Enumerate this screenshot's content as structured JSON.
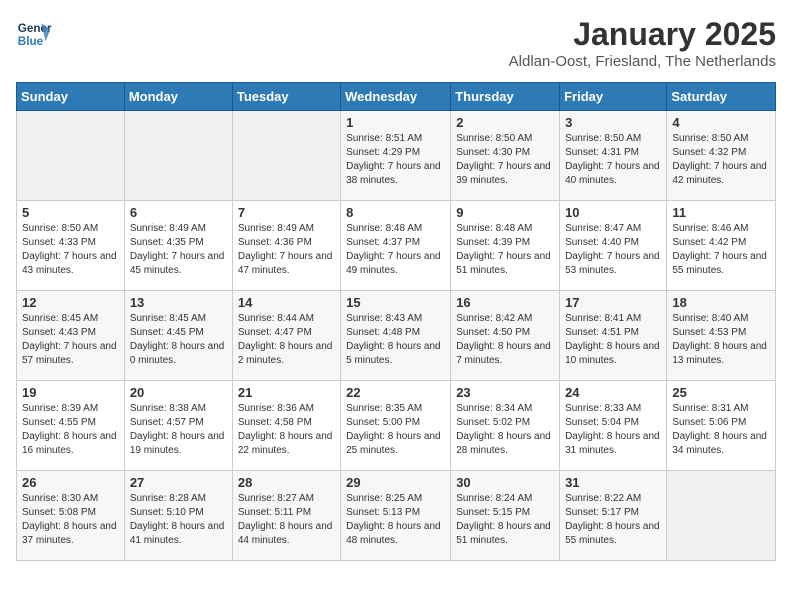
{
  "header": {
    "logo_line1": "General",
    "logo_line2": "Blue",
    "title": "January 2025",
    "subtitle": "Aldlan-Oost, Friesland, The Netherlands"
  },
  "weekdays": [
    "Sunday",
    "Monday",
    "Tuesday",
    "Wednesday",
    "Thursday",
    "Friday",
    "Saturday"
  ],
  "weeks": [
    [
      {
        "day": "",
        "info": ""
      },
      {
        "day": "",
        "info": ""
      },
      {
        "day": "",
        "info": ""
      },
      {
        "day": "1",
        "info": "Sunrise: 8:51 AM\nSunset: 4:29 PM\nDaylight: 7 hours and 38 minutes."
      },
      {
        "day": "2",
        "info": "Sunrise: 8:50 AM\nSunset: 4:30 PM\nDaylight: 7 hours and 39 minutes."
      },
      {
        "day": "3",
        "info": "Sunrise: 8:50 AM\nSunset: 4:31 PM\nDaylight: 7 hours and 40 minutes."
      },
      {
        "day": "4",
        "info": "Sunrise: 8:50 AM\nSunset: 4:32 PM\nDaylight: 7 hours and 42 minutes."
      }
    ],
    [
      {
        "day": "5",
        "info": "Sunrise: 8:50 AM\nSunset: 4:33 PM\nDaylight: 7 hours and 43 minutes."
      },
      {
        "day": "6",
        "info": "Sunrise: 8:49 AM\nSunset: 4:35 PM\nDaylight: 7 hours and 45 minutes."
      },
      {
        "day": "7",
        "info": "Sunrise: 8:49 AM\nSunset: 4:36 PM\nDaylight: 7 hours and 47 minutes."
      },
      {
        "day": "8",
        "info": "Sunrise: 8:48 AM\nSunset: 4:37 PM\nDaylight: 7 hours and 49 minutes."
      },
      {
        "day": "9",
        "info": "Sunrise: 8:48 AM\nSunset: 4:39 PM\nDaylight: 7 hours and 51 minutes."
      },
      {
        "day": "10",
        "info": "Sunrise: 8:47 AM\nSunset: 4:40 PM\nDaylight: 7 hours and 53 minutes."
      },
      {
        "day": "11",
        "info": "Sunrise: 8:46 AM\nSunset: 4:42 PM\nDaylight: 7 hours and 55 minutes."
      }
    ],
    [
      {
        "day": "12",
        "info": "Sunrise: 8:45 AM\nSunset: 4:43 PM\nDaylight: 7 hours and 57 minutes."
      },
      {
        "day": "13",
        "info": "Sunrise: 8:45 AM\nSunset: 4:45 PM\nDaylight: 8 hours and 0 minutes."
      },
      {
        "day": "14",
        "info": "Sunrise: 8:44 AM\nSunset: 4:47 PM\nDaylight: 8 hours and 2 minutes."
      },
      {
        "day": "15",
        "info": "Sunrise: 8:43 AM\nSunset: 4:48 PM\nDaylight: 8 hours and 5 minutes."
      },
      {
        "day": "16",
        "info": "Sunrise: 8:42 AM\nSunset: 4:50 PM\nDaylight: 8 hours and 7 minutes."
      },
      {
        "day": "17",
        "info": "Sunrise: 8:41 AM\nSunset: 4:51 PM\nDaylight: 8 hours and 10 minutes."
      },
      {
        "day": "18",
        "info": "Sunrise: 8:40 AM\nSunset: 4:53 PM\nDaylight: 8 hours and 13 minutes."
      }
    ],
    [
      {
        "day": "19",
        "info": "Sunrise: 8:39 AM\nSunset: 4:55 PM\nDaylight: 8 hours and 16 minutes."
      },
      {
        "day": "20",
        "info": "Sunrise: 8:38 AM\nSunset: 4:57 PM\nDaylight: 8 hours and 19 minutes."
      },
      {
        "day": "21",
        "info": "Sunrise: 8:36 AM\nSunset: 4:58 PM\nDaylight: 8 hours and 22 minutes."
      },
      {
        "day": "22",
        "info": "Sunrise: 8:35 AM\nSunset: 5:00 PM\nDaylight: 8 hours and 25 minutes."
      },
      {
        "day": "23",
        "info": "Sunrise: 8:34 AM\nSunset: 5:02 PM\nDaylight: 8 hours and 28 minutes."
      },
      {
        "day": "24",
        "info": "Sunrise: 8:33 AM\nSunset: 5:04 PM\nDaylight: 8 hours and 31 minutes."
      },
      {
        "day": "25",
        "info": "Sunrise: 8:31 AM\nSunset: 5:06 PM\nDaylight: 8 hours and 34 minutes."
      }
    ],
    [
      {
        "day": "26",
        "info": "Sunrise: 8:30 AM\nSunset: 5:08 PM\nDaylight: 8 hours and 37 minutes."
      },
      {
        "day": "27",
        "info": "Sunrise: 8:28 AM\nSunset: 5:10 PM\nDaylight: 8 hours and 41 minutes."
      },
      {
        "day": "28",
        "info": "Sunrise: 8:27 AM\nSunset: 5:11 PM\nDaylight: 8 hours and 44 minutes."
      },
      {
        "day": "29",
        "info": "Sunrise: 8:25 AM\nSunset: 5:13 PM\nDaylight: 8 hours and 48 minutes."
      },
      {
        "day": "30",
        "info": "Sunrise: 8:24 AM\nSunset: 5:15 PM\nDaylight: 8 hours and 51 minutes."
      },
      {
        "day": "31",
        "info": "Sunrise: 8:22 AM\nSunset: 5:17 PM\nDaylight: 8 hours and 55 minutes."
      },
      {
        "day": "",
        "info": ""
      }
    ]
  ]
}
